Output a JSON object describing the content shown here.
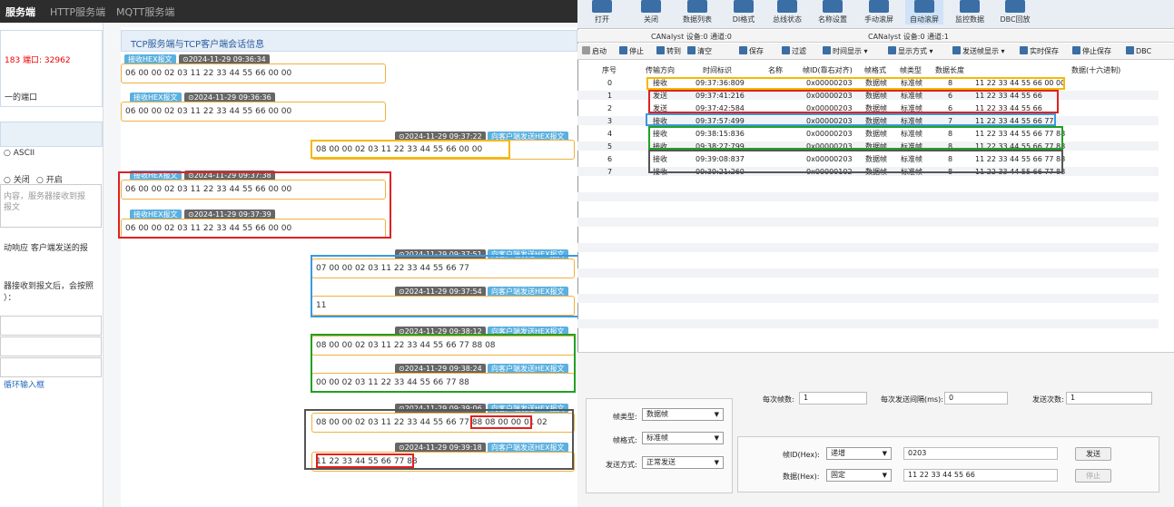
{
  "top_tabs": [
    "服务端",
    "HTTP服务端",
    "MQTT服务端"
  ],
  "settings": {
    "conn_info": "183 端口: 32962",
    "port_note": "一的端口",
    "ascii_label": "ASCII",
    "close_label": "关闭",
    "open_label": "开启",
    "hint_line1": "内容，服务器接收到报",
    "hint_line2": "报文",
    "auto_resp1": "动响应 客户端发送的报",
    "auto_resp2": "器接收到报文后，会按照",
    "auto_resp3": "）：",
    "loop_link": "循环输入框"
  },
  "session": {
    "title": "TCP服务端与TCP客户端会话信息",
    "recv_tag": "接收HEX报文",
    "send_tag": "向客户端发送HEX报文",
    "messages": [
      {
        "dir": "recv",
        "time": "2024-11-29 09:36:34",
        "text": "06 00 00 02 03 11 22 33 44 55 66 00 00"
      },
      {
        "dir": "recv",
        "time": "2024-11-29 09:36:36",
        "text": "06 00 00 02 03 11 22 33 44 55 66 00 00"
      },
      {
        "dir": "send",
        "time": "2024-11-29 09:37:22",
        "text": "08 00 00 02 03 11 22 33 44 55 66 00 00"
      },
      {
        "dir": "recv",
        "time": "2024-11-29 09:37:38",
        "text": "06 00 00 02 03 11 22 33 44 55 66 00 00"
      },
      {
        "dir": "recv",
        "time": "2024-11-29 09:37:39",
        "text": "06 00 00 02 03 11 22 33 44 55 66 00 00"
      },
      {
        "dir": "send",
        "time": "2024-11-29 09:37:51",
        "text": "07 00 00 02 03 11 22 33 44 55 66 77"
      },
      {
        "dir": "send",
        "time": "2024-11-29 09:37:54",
        "text": "11"
      },
      {
        "dir": "send",
        "time": "2024-11-29 09:38:12",
        "text": "08 00 00 02 03 11 22 33 44 55 66 77 88 08"
      },
      {
        "dir": "send",
        "time": "2024-11-29 09:38:24",
        "text": "00 00 02 03 11 22 33 44 55 66 77 88"
      },
      {
        "dir": "send",
        "time": "2024-11-29 09:39:06",
        "text": "08 00 00 02 03 11 22 33 44 55 66 77 88",
        "text_tail": "08 00 00 01 02"
      },
      {
        "dir": "send",
        "time": "2024-11-29 09:39:18",
        "text": "11 22 33 44 55 66 77 88"
      }
    ]
  },
  "toolbar": {
    "buttons": [
      "打开",
      "关闭",
      "数据列表",
      "DI格式",
      "总线状态",
      "名称设置",
      "手动滚屏",
      "自动滚屏",
      "监控数据",
      "DBC回放"
    ],
    "device_left": "CANalyst 设备:0 通道:0",
    "device_right": "CANalyst 设备:0 通道:1",
    "row2": [
      "启动",
      "停止",
      "转到",
      "清空",
      "保存",
      "过滤",
      "时间显示",
      "显示方式",
      "发送帧显示",
      "实时保存",
      "停止保存",
      "DBC"
    ]
  },
  "table": {
    "headers": [
      "序号",
      "传输方向",
      "时间标识",
      "名称",
      "帧ID(靠右对齐)",
      "帧格式",
      "帧类型",
      "数据长度",
      "数据(十六进制)"
    ],
    "rows": [
      {
        "idx": "0",
        "dir": "接收",
        "time": "09:37:36:809",
        "id": "0x00000203",
        "fmt": "数据帧",
        "type": "标准帧",
        "len": "8",
        "data": "11 22 33 44 55 66 00 00"
      },
      {
        "idx": "1",
        "dir": "发送",
        "time": "09:37:41:216",
        "id": "0x00000203",
        "fmt": "数据帧",
        "type": "标准帧",
        "len": "6",
        "data": "11 22 33 44 55 66"
      },
      {
        "idx": "2",
        "dir": "发送",
        "time": "09:37:42:584",
        "id": "0x00000203",
        "fmt": "数据帧",
        "type": "标准帧",
        "len": "6",
        "data": "11 22 33 44 55 66"
      },
      {
        "idx": "3",
        "dir": "接收",
        "time": "09:37:57:499",
        "id": "0x00000203",
        "fmt": "数据帧",
        "type": "标准帧",
        "len": "7",
        "data": "11 22 33 44 55 66 77"
      },
      {
        "idx": "4",
        "dir": "接收",
        "time": "09:38:15:836",
        "id": "0x00000203",
        "fmt": "数据帧",
        "type": "标准帧",
        "len": "8",
        "data": "11 22 33 44 55 66 77 88"
      },
      {
        "idx": "5",
        "dir": "接收",
        "time": "09:38:27:799",
        "id": "0x00000203",
        "fmt": "数据帧",
        "type": "标准帧",
        "len": "8",
        "data": "11 22 33 44 55 66 77 88"
      },
      {
        "idx": "6",
        "dir": "接收",
        "time": "09:39:08:837",
        "id": "0x00000203",
        "fmt": "数据帧",
        "type": "标准帧",
        "len": "8",
        "data": "11 22 33 44 55 66 77 88"
      },
      {
        "idx": "7",
        "dir": "接收",
        "time": "09:39:21:260",
        "id": "0x00000102",
        "fmt": "数据帧",
        "type": "标准帧",
        "len": "8",
        "data": "11 22 33 44 55 66 77 88"
      }
    ]
  },
  "send": {
    "frames_label": "每次帧数:",
    "frames_value": "1",
    "interval_label": "每次发送间隔(ms):",
    "interval_value": "0",
    "count_label": "发送次数:",
    "count_value": "1",
    "frame_type_label": "帧类型:",
    "frame_type_value": "数据帧",
    "frame_fmt_label": "帧格式:",
    "frame_fmt_value": "标准帧",
    "send_mode_label": "发送方式:",
    "send_mode_value": "正常发送",
    "id_label": "帧ID(Hex):",
    "id_mode": "递增",
    "id_value": "0203",
    "data_label": "数据(Hex):",
    "data_mode": "固定",
    "data_value": "11 22 33 44 55 66",
    "send_button": "发送",
    "stop_button": "停止"
  },
  "highlight_colors": {
    "yellow": "#f5b800",
    "red": "#e02020",
    "blue": "#3a9ae0",
    "green": "#22a022",
    "dark": "#555555"
  }
}
